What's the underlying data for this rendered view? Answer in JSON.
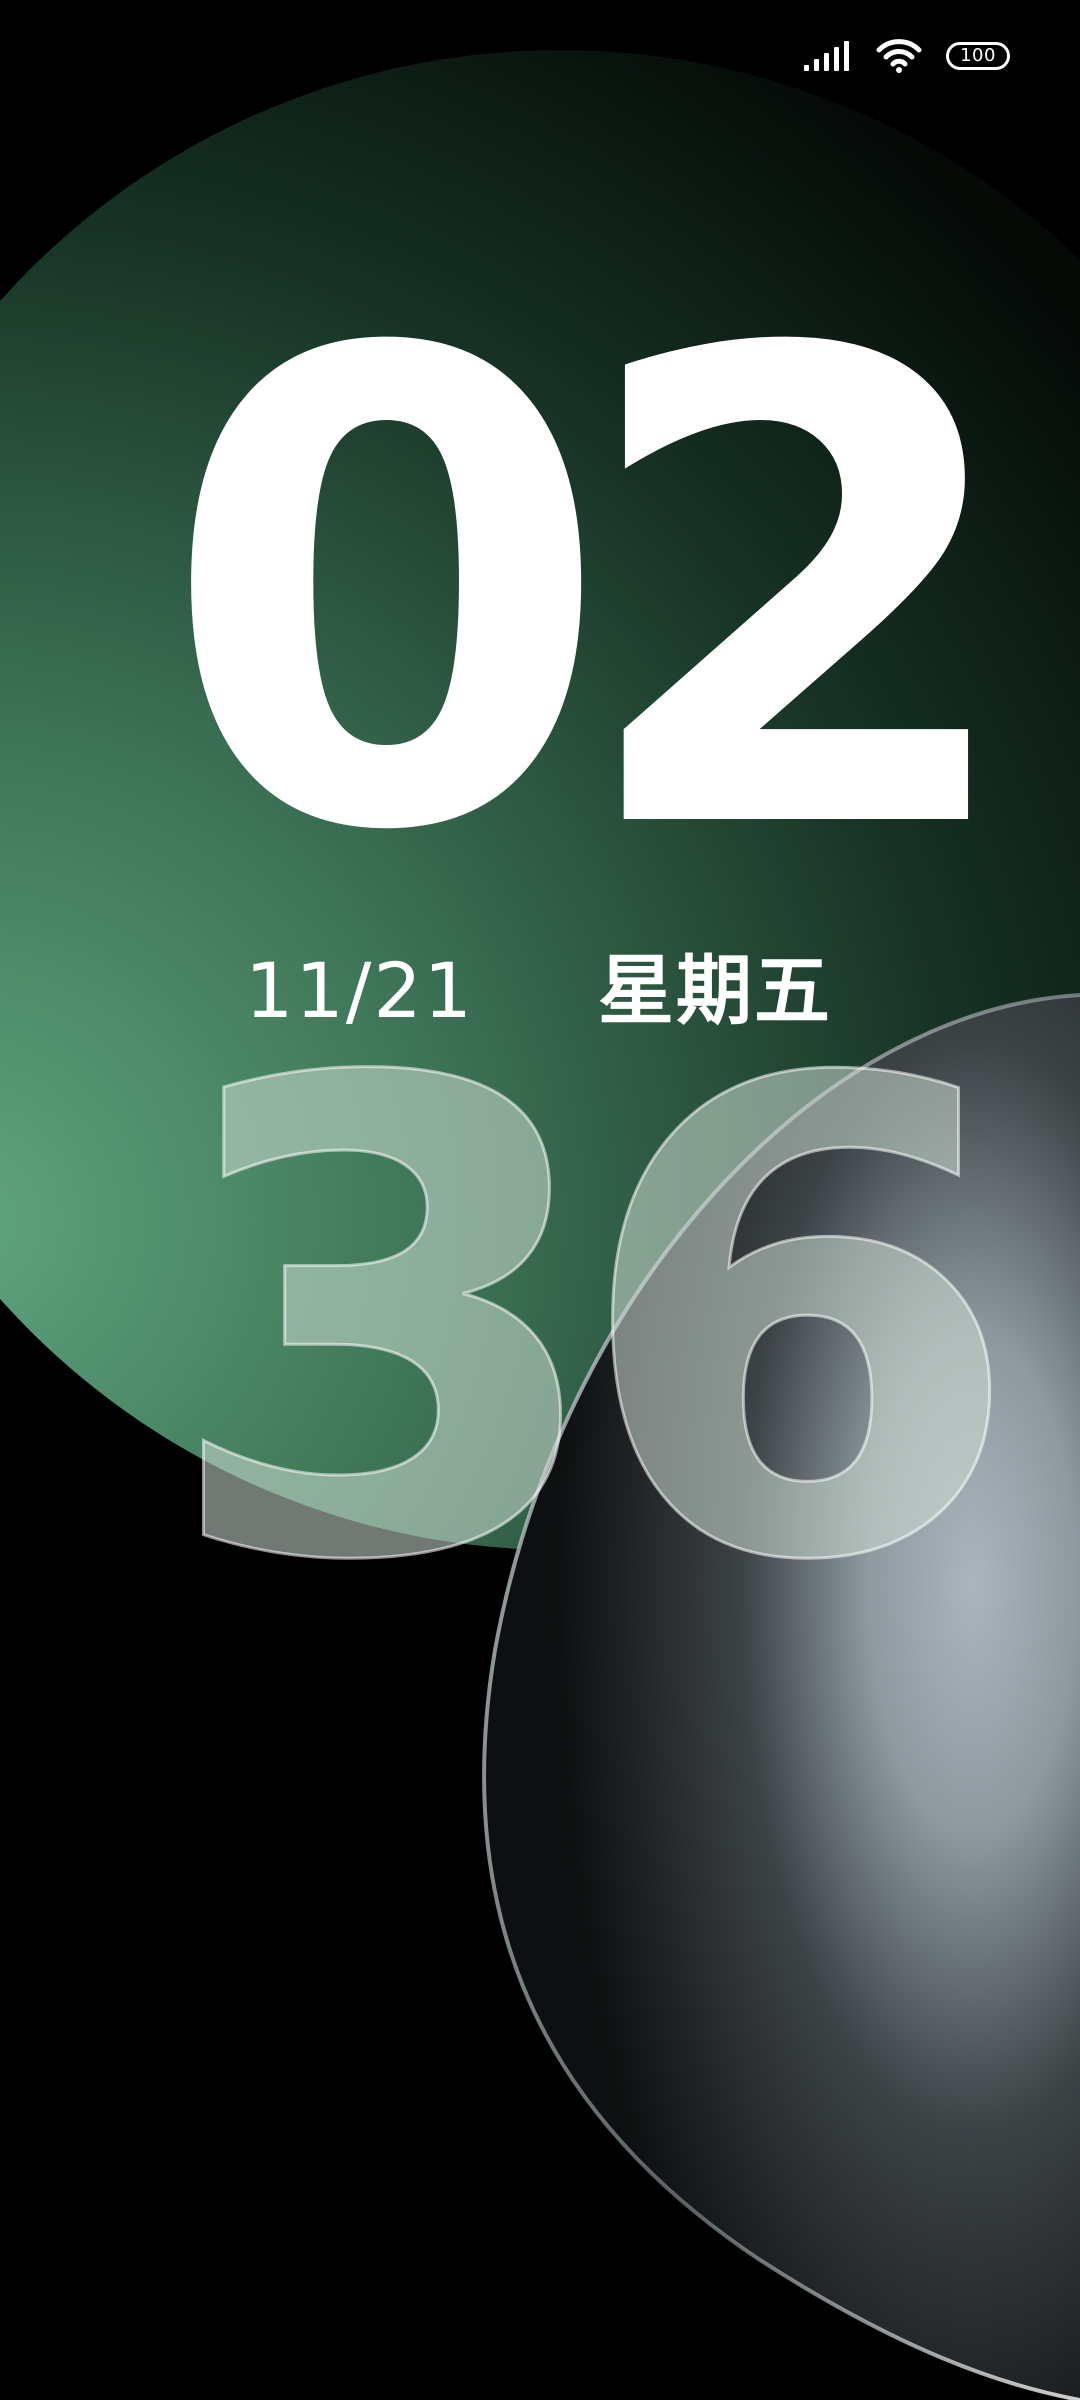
{
  "status_bar": {
    "signal_icon": "signal-strength-icon",
    "wifi_icon": "wifi-icon",
    "battery_icon": "battery-icon",
    "battery_level": "100"
  },
  "clock": {
    "hours": "02",
    "minutes": "36"
  },
  "date": {
    "date": "11/21",
    "weekday": "星期五"
  },
  "colors": {
    "background": "#000000",
    "green_accent": "#5a9e78",
    "silver_accent": "#a7b2b8",
    "text": "#ffffff"
  }
}
